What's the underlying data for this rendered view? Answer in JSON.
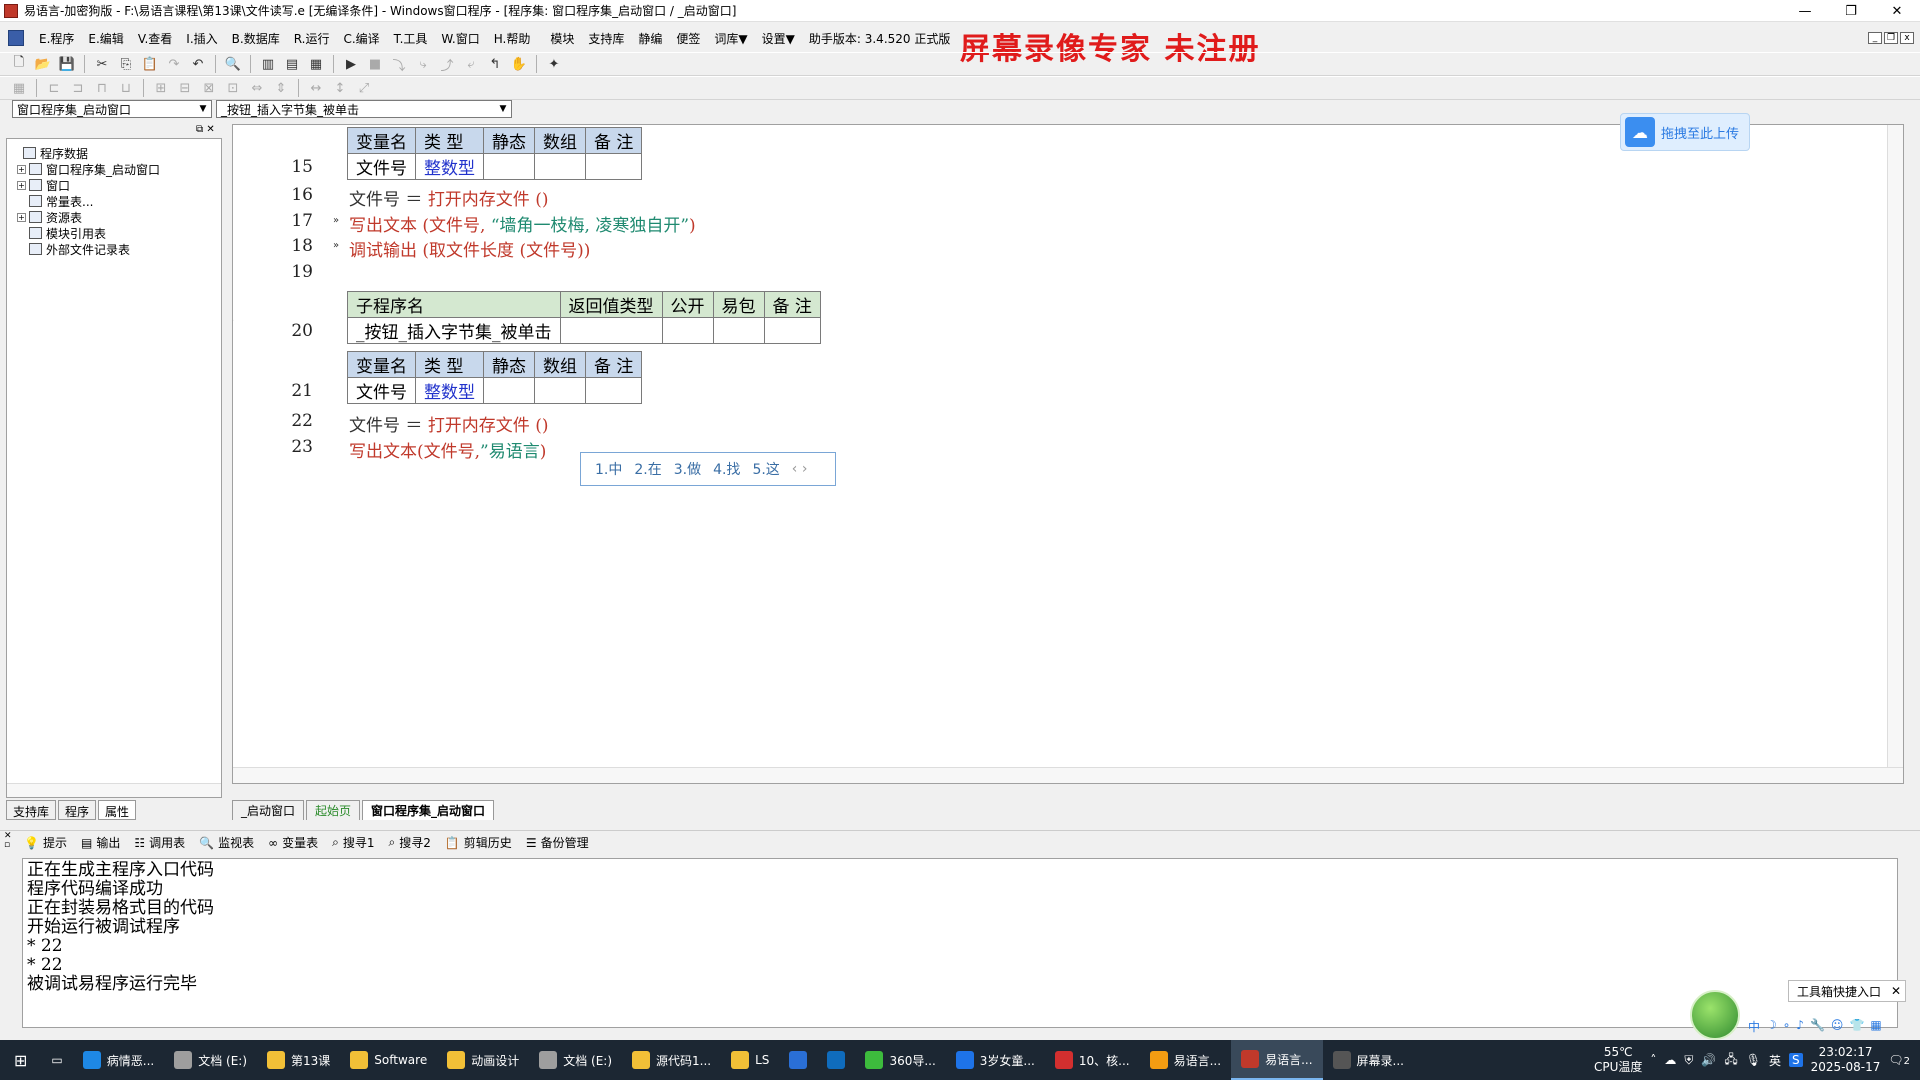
{
  "window": {
    "title": "易语言-加密狗版 - F:\\易语言课程\\第13课\\文件读写.e [无编译条件] - Windows窗口程序 - [程序集: 窗口程序集_启动窗口 / _启动窗口]"
  },
  "menu": [
    "E.程序",
    "E.编辑",
    "V.查看",
    "I.插入",
    "B.数据库",
    "R.运行",
    "C.编译",
    "T.工具",
    "W.窗口",
    "H.帮助",
    "模块",
    "支持库",
    "静编",
    "便签",
    "词库▼",
    "设置▼",
    "助手版本: 3.4.520 正式版"
  ],
  "watermark": "屏幕录像专家 未注册",
  "combos": {
    "left": "窗口程序集_启动窗口",
    "right": "_按钮_插入字节集_被单击"
  },
  "tree": [
    {
      "label": "程序数据",
      "indent": 0,
      "expander": ""
    },
    {
      "label": "窗口程序集_启动窗口",
      "indent": 1,
      "expander": "+"
    },
    {
      "label": "窗口",
      "indent": 1,
      "expander": "+"
    },
    {
      "label": "常量表...",
      "indent": 1,
      "expander": ""
    },
    {
      "label": "资源表",
      "indent": 1,
      "expander": "+"
    },
    {
      "label": "模块引用表",
      "indent": 1,
      "expander": ""
    },
    {
      "label": "外部文件记录表",
      "indent": 1,
      "expander": ""
    }
  ],
  "left_tabs": [
    "支持库",
    "程序",
    "属性"
  ],
  "upload_button": "拖拽至此上传",
  "code": {
    "var_table_1": {
      "headers": [
        "变量名",
        "类 型",
        "静态",
        "数组",
        "备 注"
      ],
      "row": [
        "文件号",
        "整数型",
        "",
        "",
        ""
      ],
      "line": "15"
    },
    "lines": [
      {
        "n": "16",
        "parts": [
          [
            "dk",
            "文件号 ＝ "
          ],
          [
            "red",
            "打开内存文件 ()"
          ]
        ]
      },
      {
        "n": "17",
        "parts": [
          [
            "red",
            "写出文本 (文件号, "
          ],
          [
            "green",
            "“墙角一枝梅, 凌寒独自开”"
          ],
          [
            "red",
            ")"
          ]
        ]
      },
      {
        "n": "18",
        "parts": [
          [
            "red",
            "调试输出 (取文件长度 (文件号))"
          ]
        ]
      },
      {
        "n": "19",
        "parts": []
      }
    ],
    "sub_table": {
      "headers": [
        "子程序名",
        "返回值类型",
        "公开",
        "易包",
        "备 注"
      ],
      "row": [
        "_按钮_插入字节集_被单击",
        "",
        "",
        "",
        ""
      ],
      "line": "20"
    },
    "var_table_2": {
      "headers": [
        "变量名",
        "类 型",
        "静态",
        "数组",
        "备 注"
      ],
      "row": [
        "文件号",
        "整数型",
        "",
        "",
        ""
      ],
      "line": "21"
    },
    "lines2": [
      {
        "n": "22",
        "parts": [
          [
            "dk",
            "文件号 ＝ "
          ],
          [
            "red",
            "打开内存文件 ()"
          ]
        ]
      },
      {
        "n": "23",
        "parts": [
          [
            "red",
            "写出文本(文件号,"
          ],
          [
            "green",
            "”易语言"
          ],
          [
            "red",
            ")"
          ]
        ]
      }
    ]
  },
  "ime_candidates": [
    "1.中",
    "2.在",
    "3.做",
    "4.找",
    "5.这"
  ],
  "editor_tabs": [
    "_启动窗口",
    "起始页",
    "窗口程序集_启动窗口"
  ],
  "bottom_tools": [
    "提示",
    "输出",
    "调用表",
    "监视表",
    "变量表",
    "搜寻1",
    "搜寻2",
    "剪辑历史",
    "备份管理"
  ],
  "output_lines": [
    "正在生成主程序入口代码",
    "程序代码编译成功",
    "正在封装易格式目的代码",
    "开始运行被调试程序",
    "* 22",
    "* 22",
    "被调试易程序运行完毕"
  ],
  "float_tip": "工具箱快捷入口",
  "taskbar": {
    "items": [
      {
        "label": "病情恶...",
        "color": "#1e88e5"
      },
      {
        "label": "文档 (E:)",
        "color": "#9e9e9e"
      },
      {
        "label": "第13课",
        "color": "#f2c037"
      },
      {
        "label": "Software",
        "color": "#f2c037"
      },
      {
        "label": "动画设计",
        "color": "#f2c037"
      },
      {
        "label": "文档 (E:)",
        "color": "#9e9e9e"
      },
      {
        "label": "源代码1...",
        "color": "#f2c037"
      },
      {
        "label": "LS",
        "color": "#f2c037"
      },
      {
        "label": "",
        "color": "#2a6fd6"
      },
      {
        "label": "",
        "color": "#0f6cbd"
      },
      {
        "label": "360导...",
        "color": "#3dbb3d"
      },
      {
        "label": "3岁女童...",
        "color": "#1e73e8"
      },
      {
        "label": "10、核...",
        "color": "#d32f2f"
      },
      {
        "label": "易语言...",
        "color": "#f39c12"
      },
      {
        "label": "易语言...",
        "color": "#c0392b"
      },
      {
        "label": "屏幕录...",
        "color": "#555"
      }
    ],
    "temp": "55℃",
    "temp_label": "CPU温度",
    "time": "23:02:17",
    "date": "2025-08-17",
    "lang": "英",
    "notify_count": "2"
  }
}
